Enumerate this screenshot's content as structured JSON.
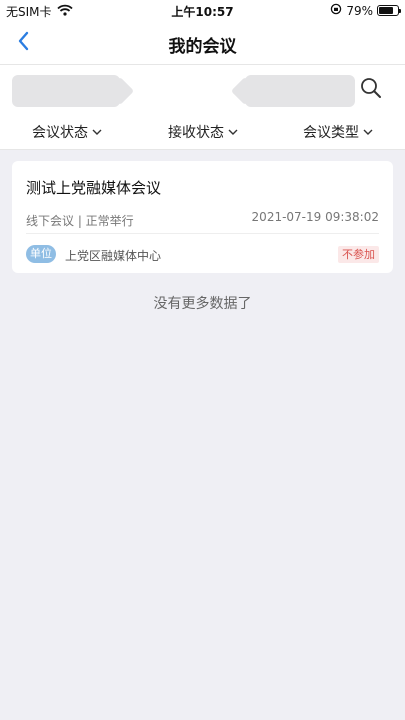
{
  "status_bar": {
    "carrier": "无SIM卡",
    "time": "上午10:57",
    "battery": "79%",
    "battery_level": 0.79
  },
  "nav": {
    "title": "我的会议",
    "back_icon": "chevron-left-icon"
  },
  "search": {
    "icon": "search-icon"
  },
  "filters": [
    {
      "label": "会议状态"
    },
    {
      "label": "接收状态"
    },
    {
      "label": "会议类型"
    }
  ],
  "meetings": [
    {
      "title": "测试上党融媒体会议",
      "meta": "线下会议 | 正常举行",
      "time": "2021-07-19 09:38:02",
      "unit_badge": "单位",
      "unit_name": "上党区融媒体中心",
      "status": "不参加"
    }
  ],
  "footer": {
    "no_more": "没有更多数据了"
  },
  "colors": {
    "accent": "#2b7de1",
    "badge": "#8fbde4",
    "status_tag_text": "#d9534f",
    "background": "#efeff4"
  }
}
